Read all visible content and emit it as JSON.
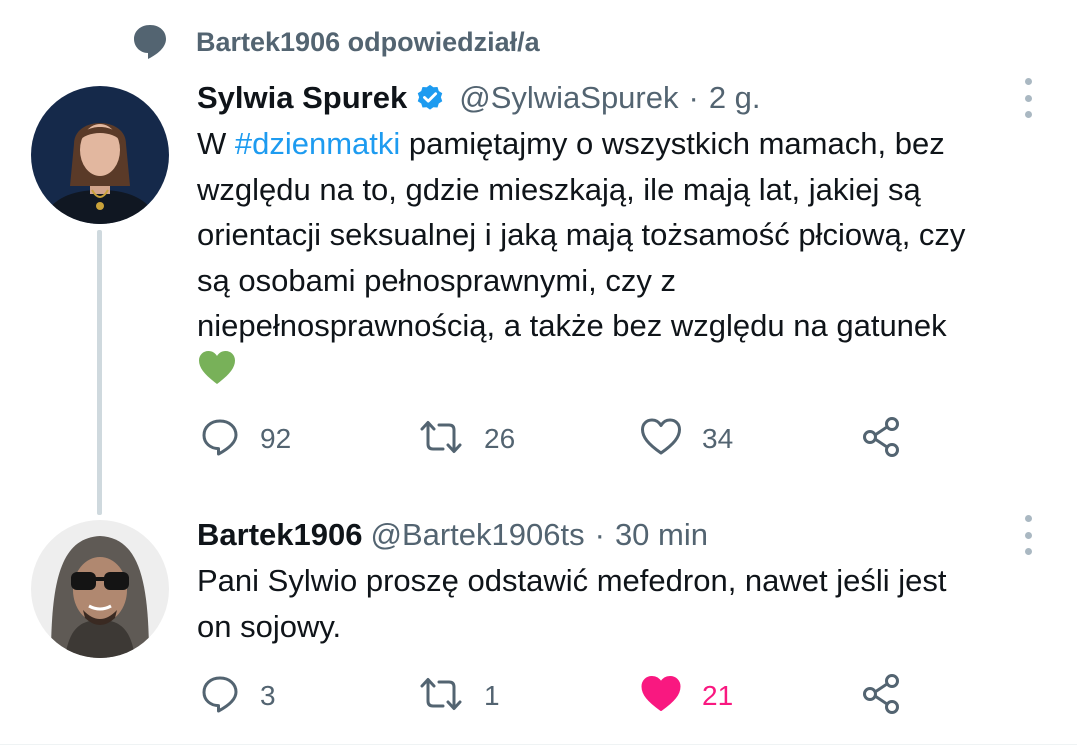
{
  "context": {
    "icon": "speech-bubble-icon",
    "text": "Bartek1906 odpowiedział/a"
  },
  "tweets": [
    {
      "name": "Sylwia Spurek",
      "verified": true,
      "handle": "@SylwiaSpurek",
      "dot": "·",
      "time": "2 g.",
      "text": {
        "line1_prefix": "W ",
        "hashtag": "#dzienmatki",
        "line1_suffix": " pamiętajmy o wszystkich mamach, bez",
        "line2": "względu na to, gdzie mieszkają, ile mają lat, jakiej są",
        "line3": "orientacji seksualnej i jaką mają tożsamość płciową, czy",
        "line4": "są osobami pełnosprawnymi, czy z",
        "line5": "niepełnosprawnością, a także bez względu na gatunek",
        "emoji": "green-heart-emoji"
      },
      "actions": {
        "replies": "92",
        "retweets": "26",
        "likes": "34",
        "liked": false
      }
    },
    {
      "name": "Bartek1906",
      "verified": false,
      "handle": "@Bartek1906ts",
      "dot": "·",
      "time": "30 min",
      "text": {
        "line1": "Pani Sylwio proszę odstawić mefedron, nawet jeśli jest",
        "line2": "on sojowy."
      },
      "actions": {
        "replies": "3",
        "retweets": "1",
        "likes": "21",
        "liked": true
      }
    }
  ],
  "colors": {
    "hashtag": "#1d9bf0",
    "verified": "#1d9bf0",
    "liked": "#f91880",
    "secondary_text": "#536471",
    "green_heart": "#78b159"
  }
}
